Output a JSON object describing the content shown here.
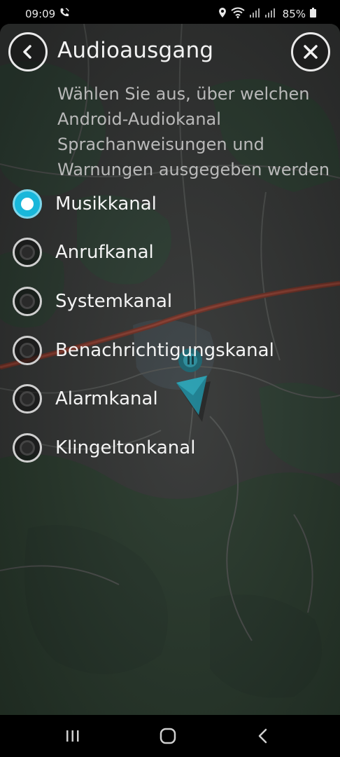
{
  "status_bar": {
    "time": "09:09",
    "battery": "85%"
  },
  "header": {
    "title": "Audioausgang"
  },
  "description": {
    "lines": [
      "Wählen Sie aus, über welchen",
      "Android-Audiokanal",
      "Sprachanweisungen und",
      "Warnungen ausgegeben werden"
    ]
  },
  "options": [
    {
      "label": "Musikkanal",
      "selected": true
    },
    {
      "label": "Anrufkanal",
      "selected": false
    },
    {
      "label": "Systemkanal",
      "selected": false
    },
    {
      "label": "Benachrichtigungskanal",
      "selected": false
    },
    {
      "label": "Alarmkanal",
      "selected": false
    },
    {
      "label": "Klingeltonkanal",
      "selected": false
    }
  ],
  "colors": {
    "accent": "#19b7da",
    "route": "#8a3a2f",
    "forest": "#2f4a33"
  }
}
